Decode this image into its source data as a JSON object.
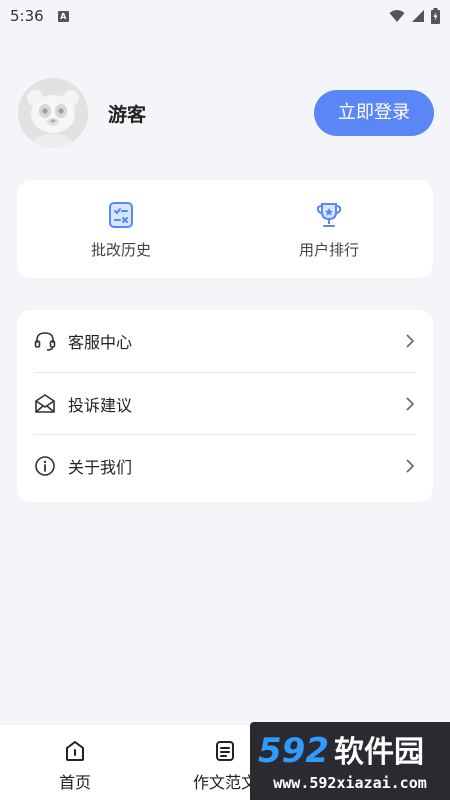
{
  "status_bar": {
    "time": "5:36",
    "notification_badge": "A"
  },
  "profile": {
    "username": "游客",
    "login_button": "立即登录"
  },
  "quick_actions": [
    {
      "label": "批改历史",
      "icon": "checklist-icon"
    },
    {
      "label": "用户排行",
      "icon": "trophy-icon"
    }
  ],
  "menu": [
    {
      "label": "客服中心",
      "icon": "headset-icon"
    },
    {
      "label": "投诉建议",
      "icon": "envelope-icon"
    },
    {
      "label": "关于我们",
      "icon": "info-icon"
    }
  ],
  "bottom_nav": [
    {
      "label": "首页",
      "icon": "home-icon"
    },
    {
      "label": "作文范文",
      "icon": "document-icon"
    }
  ],
  "watermark": {
    "brand": "592软件园",
    "url": "www.592xiazai.com"
  },
  "colors": {
    "accent": "#5b86f5",
    "background": "#f4f5f9",
    "card": "#ffffff"
  }
}
